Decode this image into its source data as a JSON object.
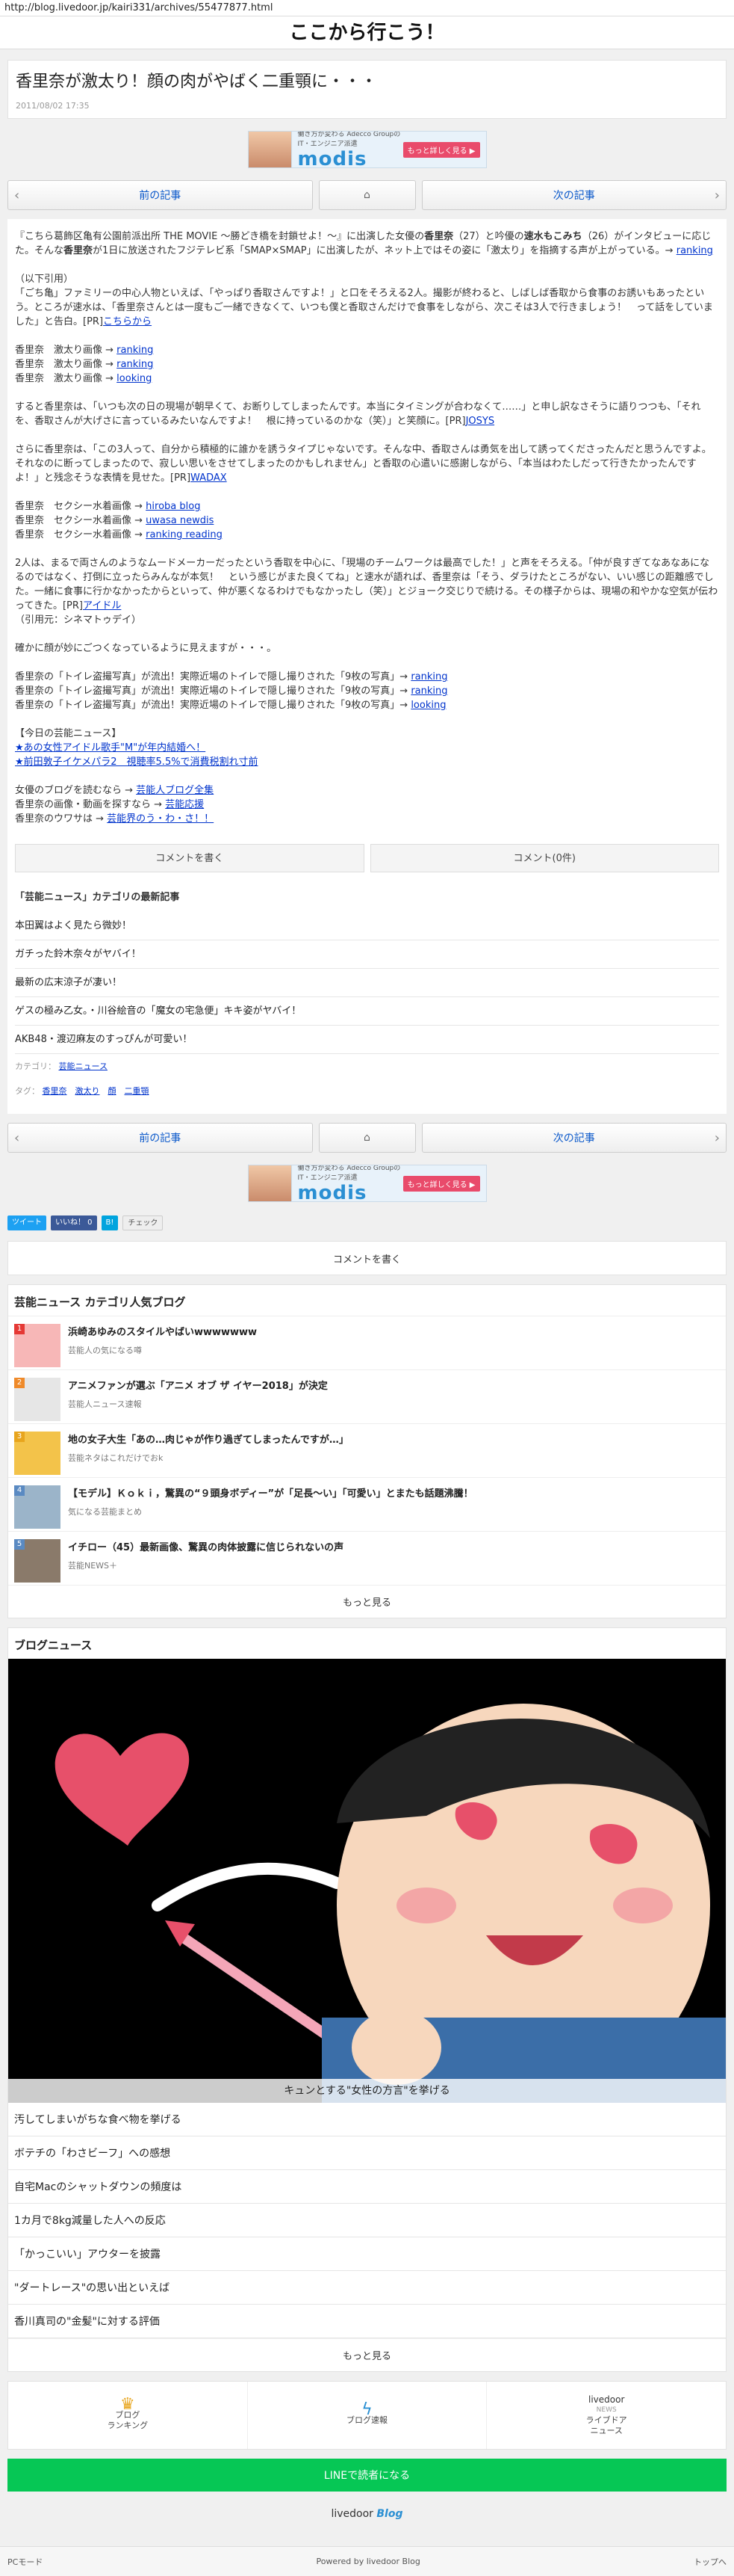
{
  "url": "http://blog.livedoor.jp/kairi331/archives/55477877.html",
  "blog_title": "ここから行こう！",
  "post": {
    "title": "香里奈が激太り！顔の肉がやばく二重顎に・・・",
    "date": "2011/08/02 17:35"
  },
  "ad": {
    "small": "働き方が変わる Adecco Groupの IT・エンジニア派遣",
    "logo": "modis",
    "btn": "もっと詳しく見る ▶"
  },
  "pager": {
    "prev": "前の記事",
    "next": "次の記事"
  },
  "body": {
    "p1_a": "『こちら葛飾区亀有公園前派出所 THE MOVIE ～勝どき橋を封鎖せよ！～』に出演した女優の",
    "p1_name": "香里奈",
    "p1_b": "（27）と吟優の",
    "p1_name2": "速水もこみち",
    "p1_c": "（26）がインタビューに応じた。そんな",
    "p1_d": "が1日に放送されたフジテレビ系「SMAP×SMAP」に出演したが、ネット上ではその姿に「激太り」を指摘する声が上がっている。→",
    "p1_link": "ranking",
    "p2_a": "（以下引用）",
    "p2_b": "「ごち亀」ファミリーの中心人物といえば、「やっぱり香取さんですよ！」と口をそろえる2人。撮影が終わると、しばしば香取から食事のお誘いもあったという。ところが速水は、「香里奈さんとは一度もご一緒できなくて、いつも僕と香取さんだけで食事をしながら、次こそは3人で行きましょう！　って話をしていました」と告白。[PR]",
    "p2_link": "こちらから",
    "r1": "香里奈　激太り画像 →",
    "r1_l": "ranking",
    "r2": "香里奈　激太り画像 →",
    "r2_l": "ranking",
    "r3": "香里奈　激太り画像 →",
    "r3_l": "looking",
    "p3": "すると香里奈は、「いつも次の日の現場が朝早くて、お断りしてしまったんです。本当にタイミングが合わなくて……」と申し訳なさそうに語りつつも、「それを、香取さんが大げさに言っているみたいなんですよ！　根に持っているのかな（笑）」と笑顔に。[PR]",
    "p3_link": "JOSYS",
    "p4": "さらに香里奈は、「この3人って、自分から積極的に誰かを誘うタイプじゃないです。そんな中、香取さんは勇気を出して誘ってくださったんだと思うんですよ。それなのに断ってしまったので、寂しい思いをさせてしまったのかもしれません」と香取の心遣いに感謝しながら、「本当はわたしだって行きたかったんですよ！」と残念そうな表情を見せた。[PR]",
    "p4_link": "WADAX",
    "s1": "香里奈　セクシー水着画像 →",
    "s1_l": "hiroba blog",
    "s2": "香里奈　セクシー水着画像 →",
    "s2_l": "uwasa newdis",
    "s3": "香里奈　セクシー水着画像 →",
    "s3_l": "ranking reading",
    "p5": "2人は、まるで両さんのようなムードメーカーだったという香取を中心に、「現場のチームワークは最高でした！」と声をそろえる。「仲が良すぎてなあなあになるのではなく、打倒に立ったらみんなが本気！　という感じがまた良くてね」と速水が語れば、香里奈は「そう、ダラけたところがない、いい感じの距離感でした。一緒に食事に行かなかったからといって、仲が悪くなるわけでもなかったし（笑）」とジョーク交じりで続ける。その様子からは、現場の和やかな空気が伝わってきた。[PR]",
    "p5_link": "アイドル",
    "p5_src": "（引用元：シネマトゥデイ）",
    "p6": "確かに顔が妙にごつくなっているように見えますが・・・。",
    "t1": "香里奈の「トイレ盗撮写真」が流出！実際近場のトイレで隠し撮りされた「9枚の写真」→",
    "t1_l": "ranking",
    "t2": "香里奈の「トイレ盗撮写真」が流出！実際近場のトイレで隠し撮りされた「9枚の写真」→",
    "t2_l": "ranking",
    "t3": "香里奈の「トイレ盗撮写真」が流出！実際近場のトイレで隠し撮りされた「9枚の写真」→",
    "t3_l": "looking",
    "today_h": "【今日の芸能ニュース】",
    "today1": "★あの女性アイドル歌手\"M\"が年内結婚へ！",
    "today2": "★前田敦子イケメパラ2　視聴率5.5%で消費税割れ寸前",
    "f1": "女優のブログを読むなら →",
    "f1_l": "芸能人ブログ全集",
    "f2": "香里奈の画像・動画を探すなら →",
    "f2_l": "芸能応援",
    "f3": "香里奈のウワサは →",
    "f3_l": "芸能界のう・わ・さ！！"
  },
  "comment_write": "コメントを書く",
  "comment_count": "コメント(0件)",
  "related": {
    "title": "「芸能ニュース」カテゴリの最新記事",
    "items": [
      "本田翼はよく見たら微妙！",
      "ガチった鈴木奈々がヤバイ！",
      "最新の広末涼子が凄い！",
      "ゲスの極み乙女。・川谷絵音の「魔女の宅急便」キキ姿がヤバイ！",
      "AKB48・渡辺麻友のすっぴんが可愛い！"
    ]
  },
  "meta": {
    "cat_label": "カテゴリ：",
    "cat": "芸能ニュース",
    "tag_label": "タグ：",
    "tags": [
      "香里奈",
      "激太り",
      "顔",
      "二重顎"
    ]
  },
  "social": {
    "tweet": "ツイート",
    "like": "いいね！ 0",
    "hatena": "B!",
    "check": "チェック"
  },
  "popular": {
    "title": "芸能ニュース カテゴリ人気ブログ",
    "items": [
      {
        "rank": "1",
        "title": "浜崎あゆみのスタイルやばいwwwwwww",
        "sub": "芸能人の気になる噂"
      },
      {
        "rank": "2",
        "title": "アニメファンが選ぶ「アニメ オブ ザ イヤー2018」が決定",
        "sub": "芸能人ニュース速報"
      },
      {
        "rank": "3",
        "title": "地の女子大生「あの…肉じゃが作り過ぎてしまったんですが…」",
        "sub": "芸能ネタはこれだけでおk"
      },
      {
        "rank": "4",
        "title": "【モデル】Ｋｏｋｉ，驚異の“９頭身ボディー”が「足長～い」「可愛い」とまたも話題沸騰！",
        "sub": "気になる芸能まとめ"
      },
      {
        "rank": "5",
        "title": "イチロー（45）最新画像、驚異の肉体披露に信じられないの声",
        "sub": "芸能NEWS＋"
      }
    ],
    "more": "もっと見る"
  },
  "blognews": {
    "title": "ブログニュース",
    "caption": "キュンとする\"女性の方言\"を挙げる",
    "items": [
      "汚してしまいがちな食べ物を挙げる",
      "ボテチの「わさビーフ」への感想",
      "自宅Macのシャットダウンの頻度は",
      "1カ月で8kg減量した人への反応",
      "「かっこいい」アウターを披露",
      "\"ダートレース\"の思い出といえば",
      "香川真司の\"金髪\"に対する評価"
    ],
    "more": "もっと見る"
  },
  "footnav": {
    "rank1": "ブログ",
    "rank2": "ランキング",
    "flash": "ブログ速報",
    "ld1": "livedoor",
    "ld2": "NEWS",
    "ld3": "ライブドア",
    "ld4": "ニュース"
  },
  "line": "LINEで読者になる",
  "ldlogo": {
    "a": "livedoor",
    "b": "Blog"
  },
  "bottom": {
    "pc": "PCモード",
    "powered": "Powered by livedoor Blog",
    "top": "トップへ"
  }
}
